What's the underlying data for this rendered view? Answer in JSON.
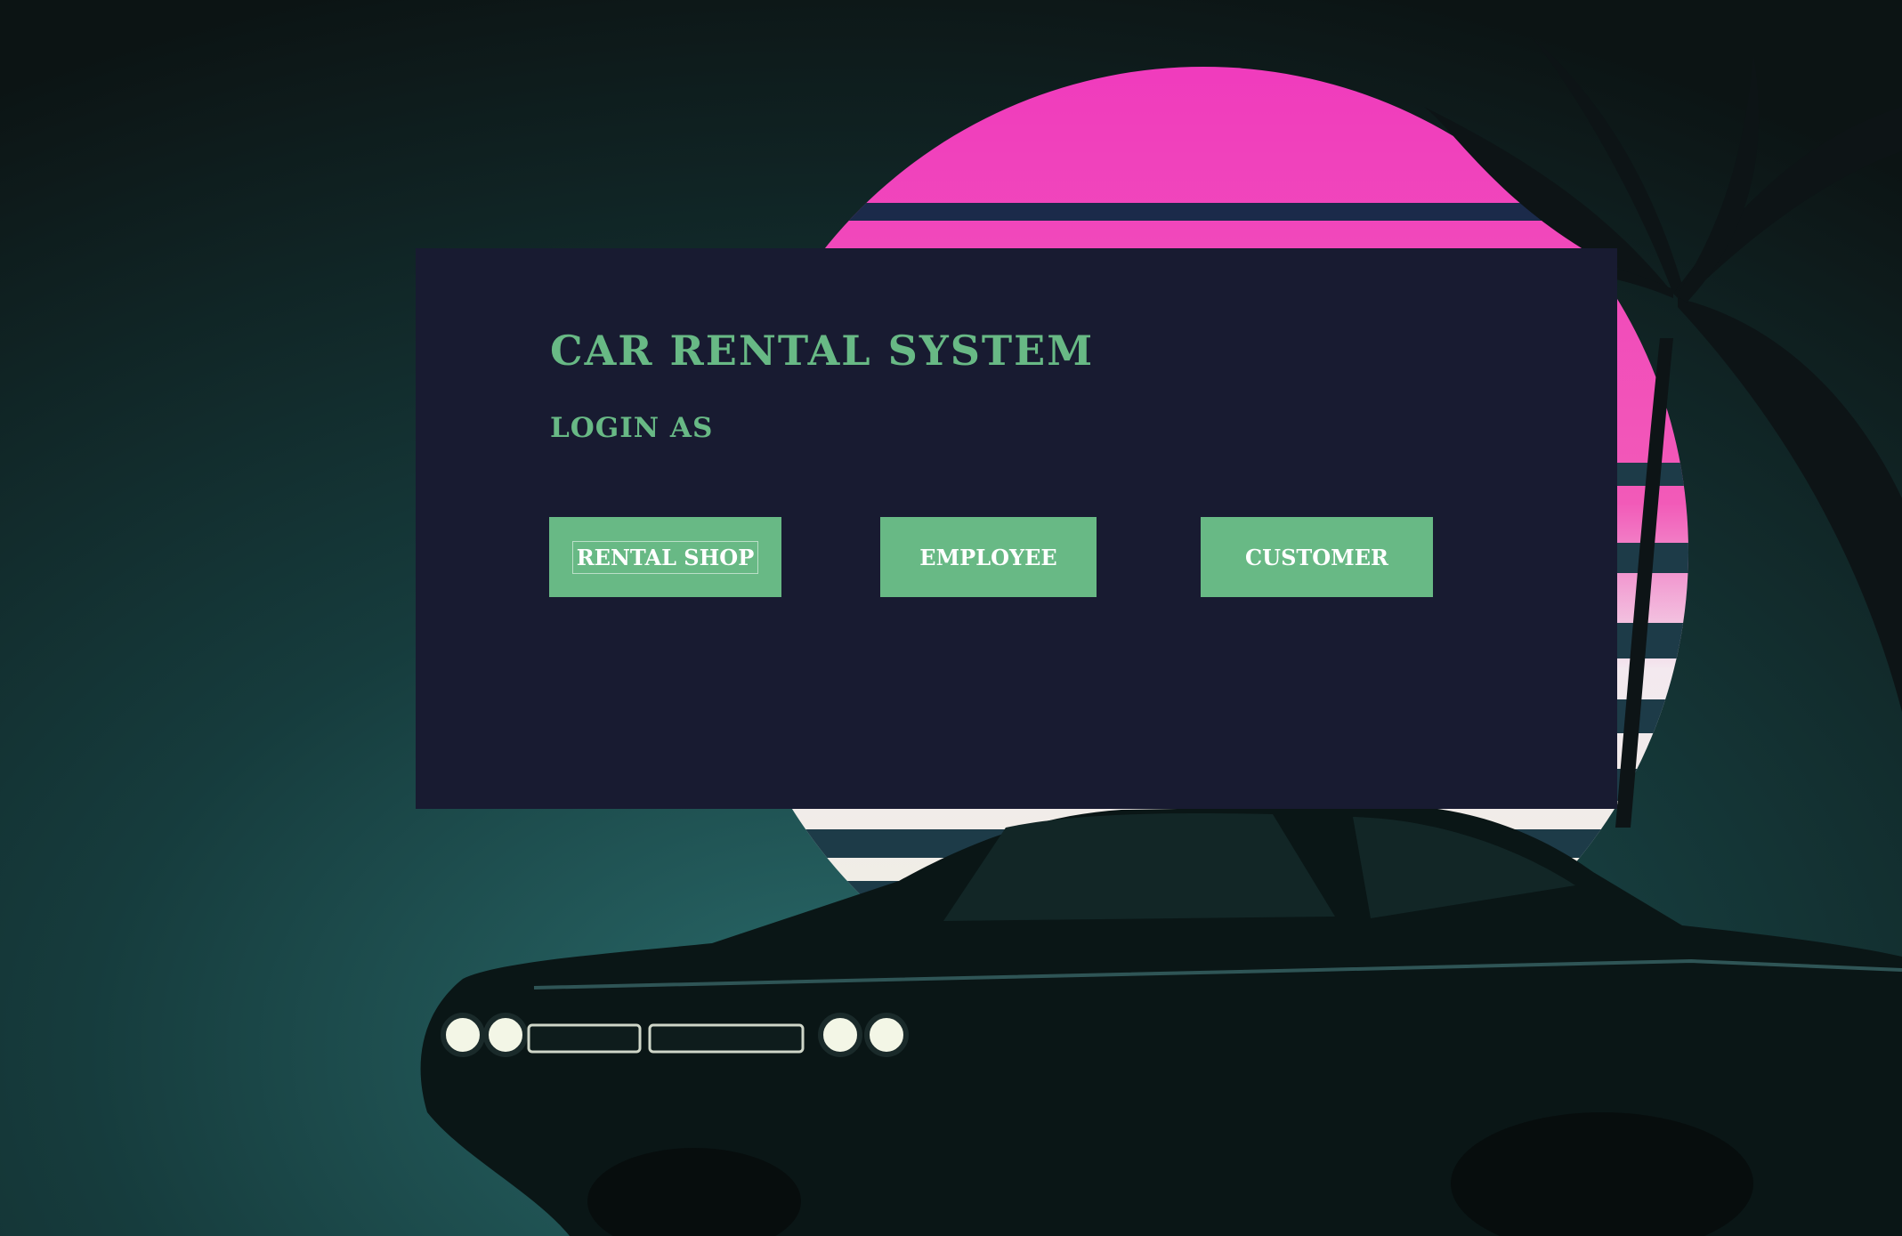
{
  "page": {
    "title": "Car Rental System",
    "subtitle": "Login As"
  },
  "login_options": {
    "rental_shop": "Rental Shop",
    "employee": "Employee",
    "customer": "Customer"
  },
  "colors": {
    "accent": "#68b985",
    "panel": "#181b31",
    "button_text": "#ffffff",
    "sun_top": "#f23ab8",
    "sun_bottom": "#f0f0de",
    "background": "#0e1a1c"
  }
}
